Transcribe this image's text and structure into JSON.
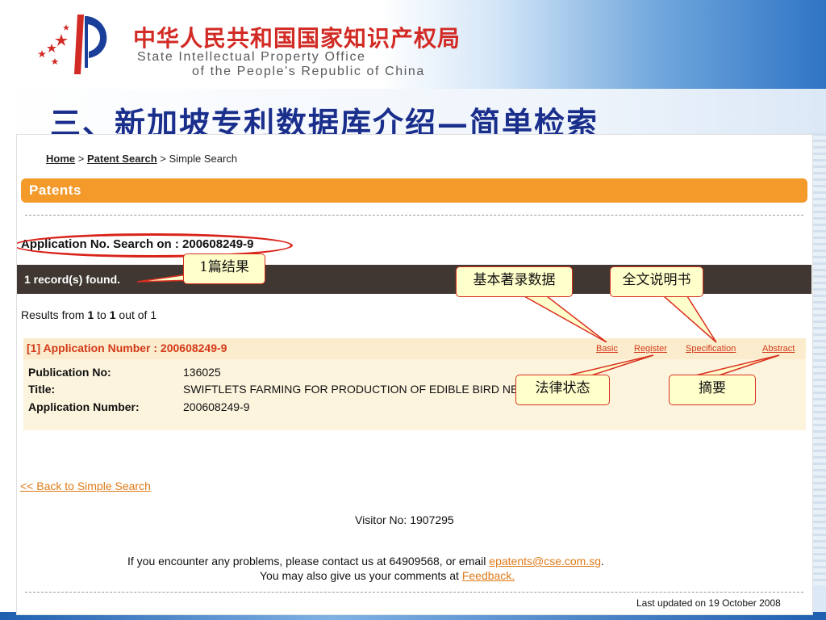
{
  "slide": {
    "org_name_cn": "中华人民共和国国家知识产权局",
    "org_name_en_line1": "State Intellectual Property Office",
    "org_name_en_line2": "of the People's Republic of China",
    "title": "三、新加坡专利数据库介绍—简单检索",
    "colors": {
      "title": "#1a2f8c",
      "org_cn": "#d22a24",
      "accent_orange": "#f39a2b",
      "callout_border": "#d93020"
    }
  },
  "page": {
    "breadcrumb": {
      "home": "Home",
      "sep1": ">",
      "patent_search": "Patent Search",
      "sep2": ">",
      "current": "Simple Search"
    },
    "section_title": "Patents",
    "search_label": "Application No. Search on : 200608249-9",
    "records_found": "1 record(s) found.",
    "results": {
      "prefix": "Results from",
      "from": "1",
      "to_word": "to",
      "to": "1",
      "suffix": "out of 1"
    },
    "result": {
      "header": "[1] Application Number : 200608249-9",
      "links": {
        "basic": "Basic",
        "register": "Register",
        "specification": "Specification",
        "abstract": "Abstract"
      },
      "fields": [
        {
          "label": "Publication No:",
          "value": "136025"
        },
        {
          "label": "Title:",
          "value": "SWIFTLETS FARMING FOR PRODUCTION OF EDIBLE BIRD NESTS"
        },
        {
          "label": "Application Number:",
          "value": "200608249-9"
        }
      ]
    },
    "back_link": "<< Back to Simple Search",
    "visitor": "Visitor No: 1907295",
    "contact": {
      "text": "If you encounter any problems, please contact us at 64909568, or email",
      "email": "epatents@cse.com.sg",
      "end": "."
    },
    "comments": {
      "text": "You may also give us your comments at",
      "link": "Feedback."
    },
    "last_updated": "Last updated on 19 October 2008"
  },
  "callouts": {
    "record_count": "1篇结果",
    "basic": "基本著录数据",
    "specification": "全文说明书",
    "register": "法律状态",
    "abstract": "摘要"
  }
}
